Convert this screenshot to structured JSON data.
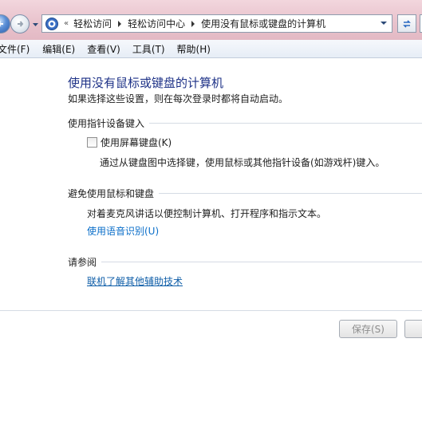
{
  "nav": {
    "breadcrumb_overflow": "«",
    "breadcrumbs": [
      "轻松访问",
      "轻松访问中心",
      "使用没有鼠标或键盘的计算机"
    ]
  },
  "menu": [
    "文件(F)",
    "编辑(E)",
    "查看(V)",
    "工具(T)",
    "帮助(H)"
  ],
  "page": {
    "title": "使用没有鼠标或键盘的计算机",
    "subtitle": "如果选择这些设置，则在每次登录时都将自动启动。"
  },
  "sections": {
    "pointing": {
      "heading": "使用指针设备键入",
      "checkbox_label": "使用屏幕键盘(K)",
      "checkbox_checked": false,
      "description": "通过从键盘图中选择键，使用鼠标或其他指针设备(如游戏杆)键入。"
    },
    "avoid": {
      "heading": "避免使用鼠标和键盘",
      "description": "对着麦克风讲话以便控制计算机、打开程序和指示文本。",
      "link": "使用语音识别(U)"
    },
    "see_also": {
      "heading": "请参阅",
      "link": "联机了解其他辅助技术"
    }
  },
  "buttons": {
    "save": "保存(S)"
  },
  "colors": {
    "title": "#1e3287",
    "link": "#0a6ec9",
    "titlebar": "#e9c3cd"
  }
}
